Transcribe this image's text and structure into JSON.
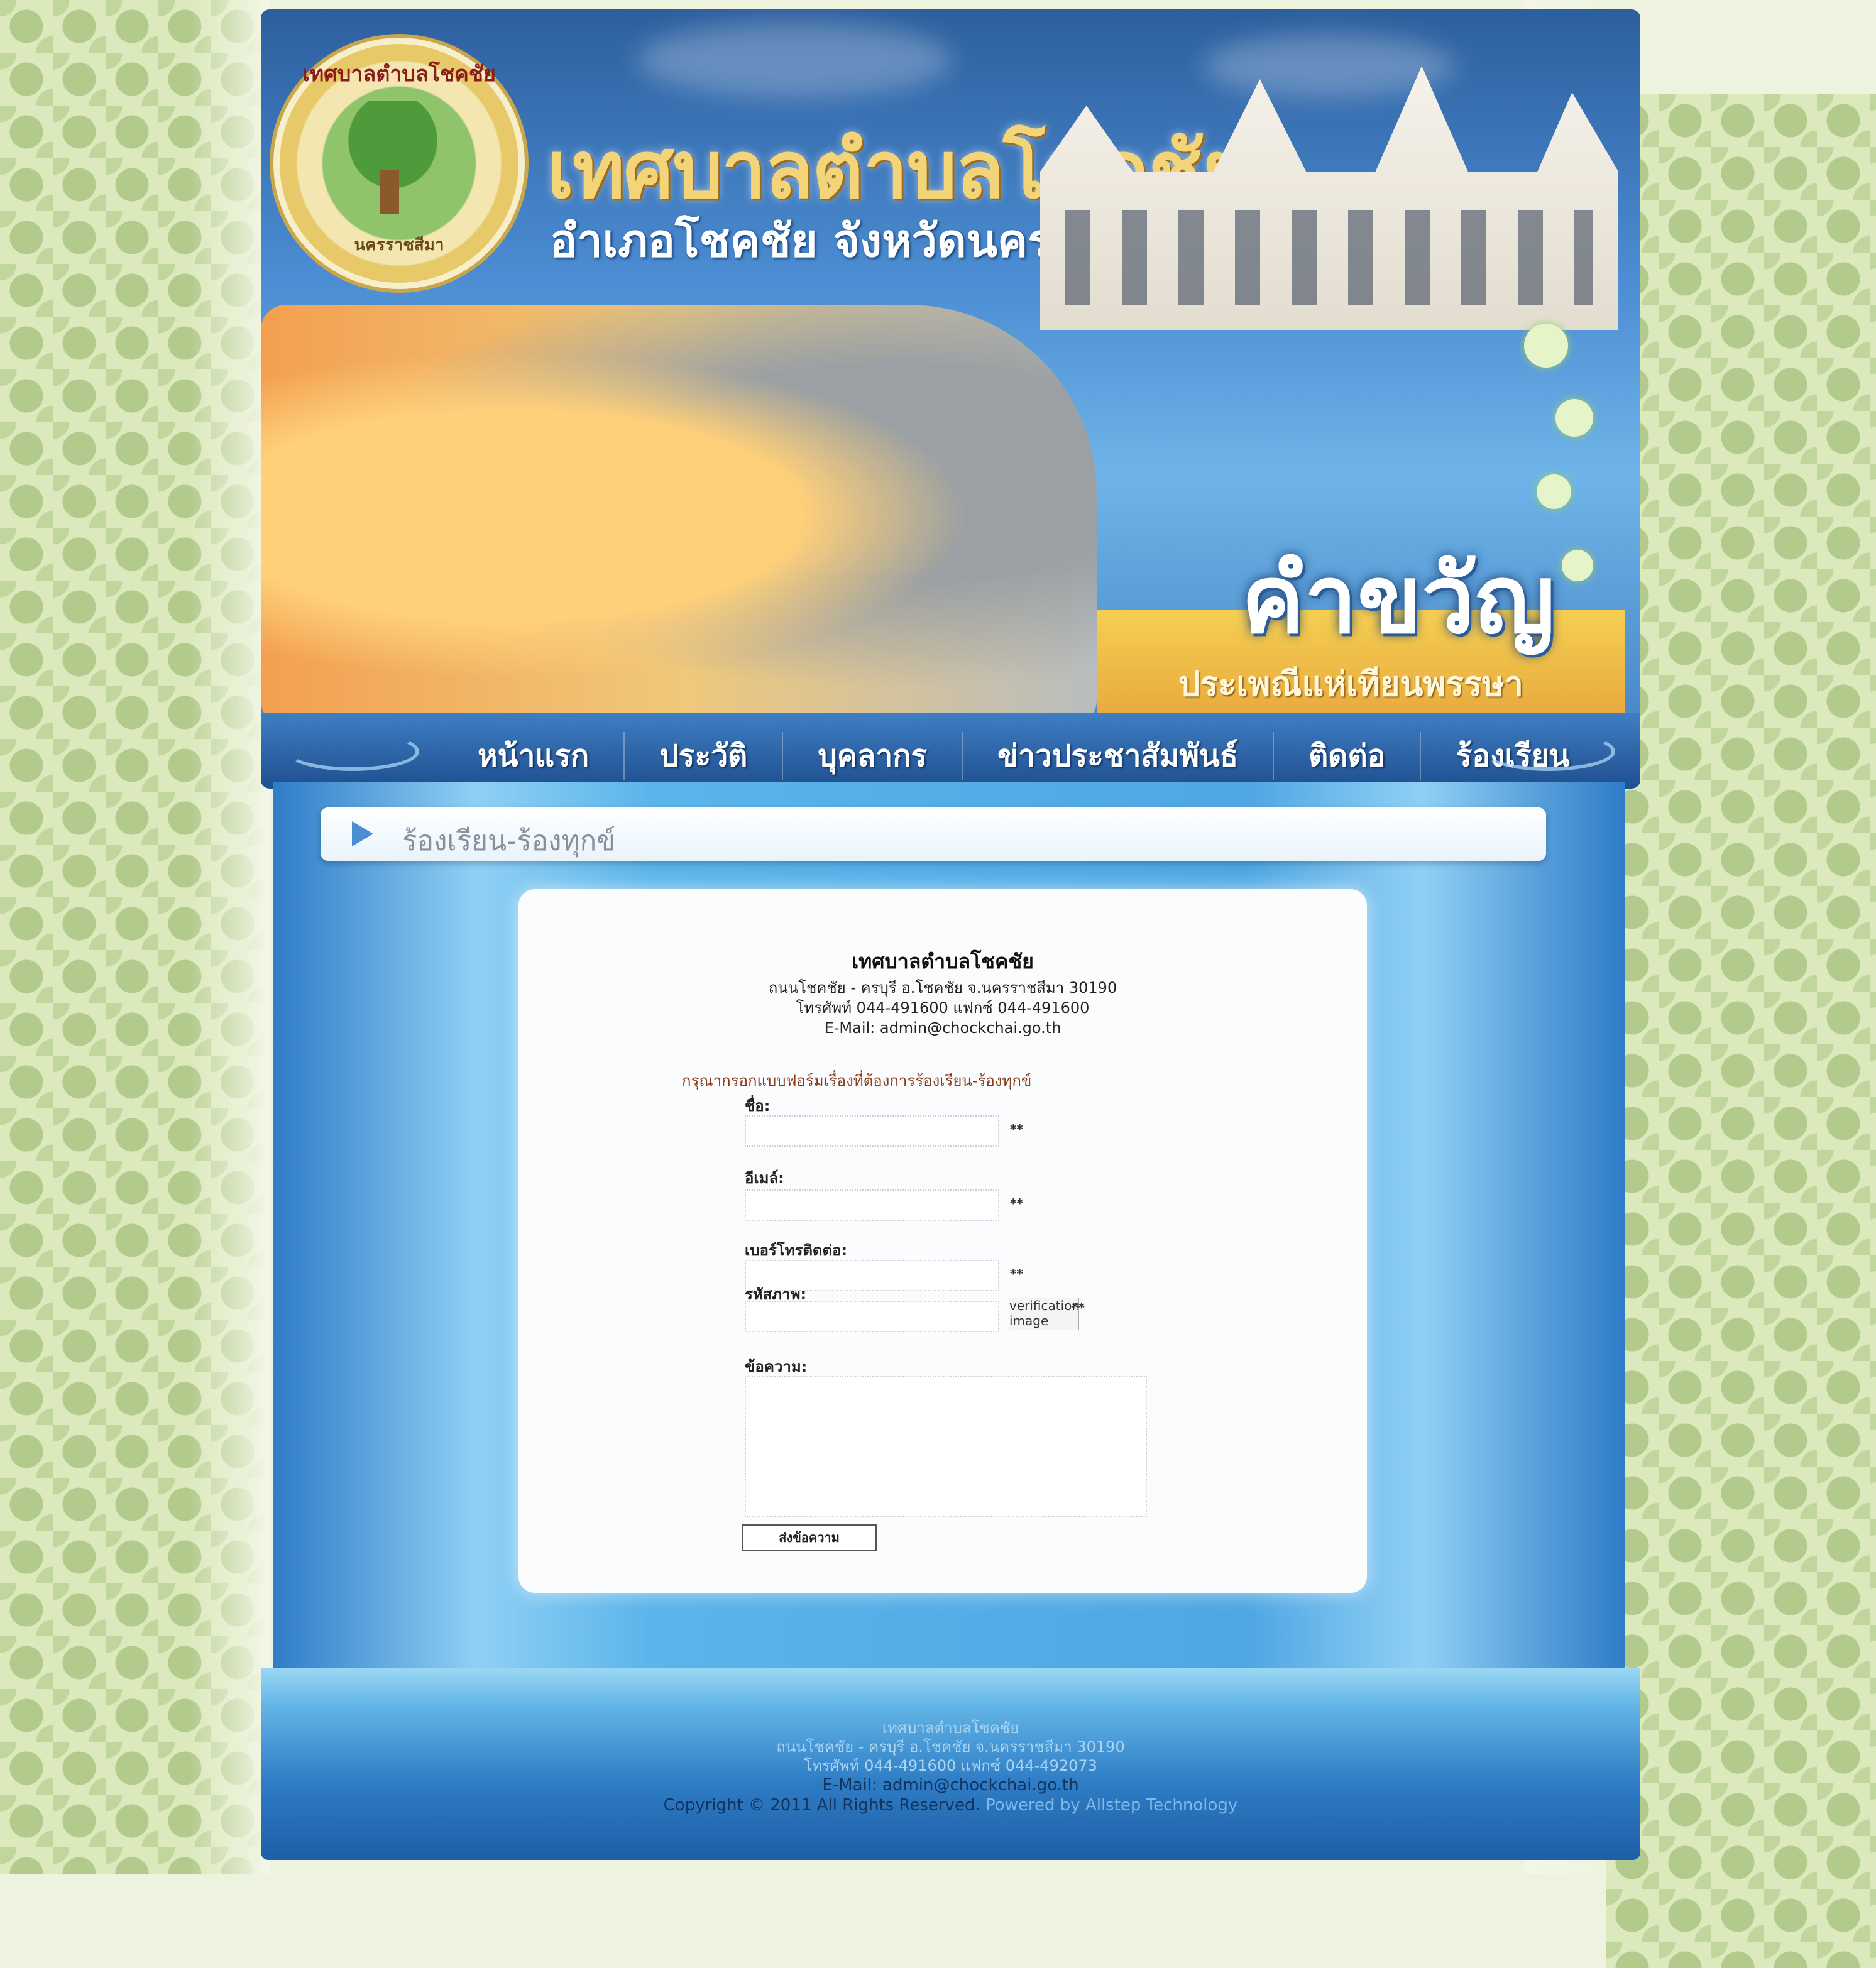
{
  "header": {
    "seal_top_text": "เทศบาลตำบลโชคชัย",
    "seal_bottom_text": "นครราชสีมา",
    "site_title": "เทศบาลตำบลโชคชัย",
    "site_subtitle": "อำเภอโชคชัย จังหวัดนครราชสีมา",
    "welcome": "คำขวัญ",
    "gold_strip": "ประเพณีแห่เทียนพรรษา"
  },
  "nav": {
    "items": [
      "หน้าแรก",
      "ประวัติ",
      "บุคลากร",
      "ข่าวประชาสัมพันธ์",
      "ติดต่อ",
      "ร้องเรียน"
    ]
  },
  "breadcrumb": {
    "text": "ร้องเรียน-ร้องทุกข์"
  },
  "org": {
    "name": "เทศบาลตำบลโชคชัย",
    "address": "ถนนโชคชัย - ครบุรี อ.โชคชัย จ.นครราชสีมา 30190",
    "phone": "โทรศัพท์ 044-491600 แฟกซ์ 044-491600",
    "email": "E-Mail: admin@chockchai.go.th"
  },
  "form": {
    "intro": "กรุณากรอกแบบฟอร์มเรื่องที่ต้องการร้องเรียน-ร้องทุกข์",
    "name_label": "ชื่อ:",
    "email_label": "อีเมล์:",
    "phone_label": "เบอร์โทรติดต่อ:",
    "captcha_label": "รหัสภาพ:",
    "message_label": "ข้อความ:",
    "required_mark": "**",
    "captcha_alt": "verification image",
    "submit_label": "ส่งข้อความ"
  },
  "footer": {
    "org_name": "เทศบาลตำบลโชคชัย",
    "address": "ถนนโชคชัย - ครบุรี อ.โชคชัย จ.นครราชสีมา 30190",
    "phone": "โทรศัพท์ 044-491600 แฟกซ์ 044-492073",
    "email": "E-Mail: admin@chockchai.go.th",
    "copyright": "Copyright © 2011 All Rights Reserved.",
    "powered": "Powered by Allstep Technology"
  }
}
